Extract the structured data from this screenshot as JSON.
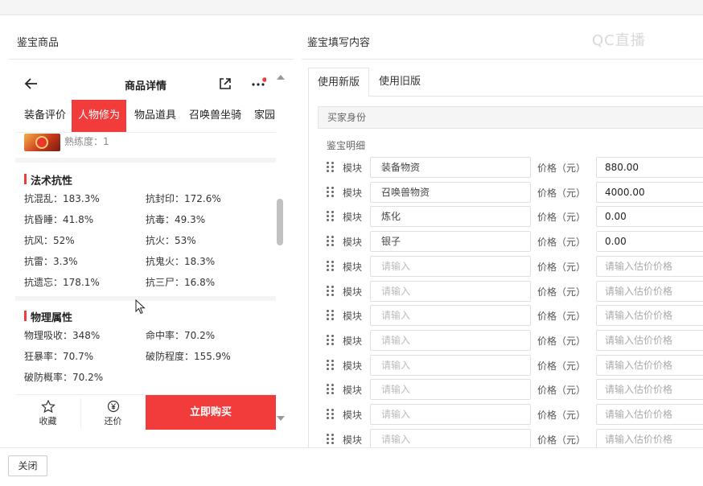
{
  "left_panel": {
    "title": "鉴宝商品"
  },
  "right_panel": {
    "title": "鉴宝填写内容"
  },
  "watermark": "QC直播",
  "phone": {
    "title": "商品详情",
    "tabs": [
      "装备评价",
      "人物修为",
      "物品道具",
      "召唤兽坐骑",
      "家园"
    ],
    "active_tab": "人物修为",
    "proficiency": "熟练度：1",
    "magic_resist": {
      "title": "法术抗性",
      "stats": [
        "抗混乱：183.3%",
        "抗封印：172.6%",
        "抗昏睡：41.8%",
        "抗毒：49.3%",
        "抗风：52%",
        "抗火：53%",
        "抗雷：3.3%",
        "抗鬼火：18.3%",
        "抗遗忘：178.1%",
        "抗三尸：16.8%"
      ]
    },
    "physical": {
      "title": "物理属性",
      "stats": [
        "物理吸收：348%",
        "命中率：70.2%",
        "狂暴率：70.7%",
        "破防程度：155.9%",
        "破防概率：70.2%"
      ]
    },
    "footer": {
      "favorite": "收藏",
      "bargain": "还价",
      "buy": "立即购买"
    }
  },
  "form": {
    "tabs": [
      "使用新版",
      "使用旧版"
    ],
    "active_tab": "使用新版",
    "buyer_identity": "买家身份",
    "detail_label": "鉴宝明细",
    "row_label": "模块",
    "price_label": "价格（元）",
    "name_placeholder": "请输入",
    "price_placeholder": "请输入估价价格",
    "rows": [
      {
        "name": "装备物资",
        "price": "880.00"
      },
      {
        "name": "召唤兽物资",
        "price": "4000.00"
      },
      {
        "name": "炼化",
        "price": "0.00"
      },
      {
        "name": "银子",
        "price": "0.00"
      },
      {
        "name": "",
        "price": ""
      },
      {
        "name": "",
        "price": ""
      },
      {
        "name": "",
        "price": ""
      },
      {
        "name": "",
        "price": ""
      },
      {
        "name": "",
        "price": ""
      },
      {
        "name": "",
        "price": ""
      },
      {
        "name": "",
        "price": ""
      },
      {
        "name": "",
        "price": ""
      }
    ]
  },
  "close_button": "关闭",
  "colors": {
    "accent_red": "#f23c3c",
    "border": "#dcdfe6"
  }
}
